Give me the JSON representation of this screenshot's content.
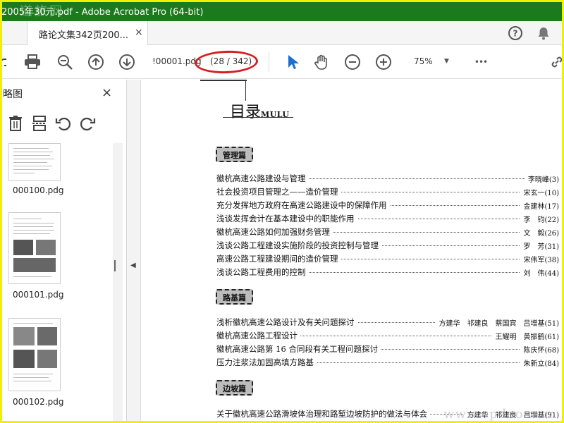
{
  "window": {
    "title": "2005年30元.pdf - Adobe Acrobat Pro (64-bit)",
    "watermark": "道旅网"
  },
  "tab": {
    "label": "路论文集342页200...",
    "close": "×"
  },
  "toolbar": {
    "filename": "!00001.pdg",
    "page_count": "(28 / 342)",
    "zoom": "75%",
    "more": "•••"
  },
  "sidebar": {
    "title": "略图",
    "close": "×",
    "thumbnails": [
      {
        "label": "000100.pdg"
      },
      {
        "label": "000101.pdg"
      },
      {
        "label": "000102.pdg"
      }
    ]
  },
  "document": {
    "heading": "目录",
    "heading_sub": "MULU",
    "sections": [
      {
        "name": "管理篇",
        "entries": [
          {
            "title": "徽杭高速公路建设与管理",
            "author": "李晓峰(3)"
          },
          {
            "title": "社会投资项目管理之——造价管理",
            "author": "宋玄一(10)"
          },
          {
            "title": "充分发挥地方政府在高速公路建设中的保障作用",
            "author": "金建林(17)"
          },
          {
            "title": "浅谈发挥会计在基本建设中的职能作用",
            "author": "李　钧(22)"
          },
          {
            "title": "徽杭高速公路如何加强财务管理",
            "author": "文　毅(26)"
          },
          {
            "title": "浅谈公路工程建设实施阶段的投资控制与管理",
            "author": "罗　芳(31)"
          },
          {
            "title": "高速公路工程建设期间的造价管理",
            "author": "宋伟军(38)"
          },
          {
            "title": "浅谈公路工程费用的控制",
            "author": "刘　伟(44)"
          }
        ]
      },
      {
        "name": "路基篇",
        "entries": [
          {
            "title": "浅析徽杭高速公路设计及有关问题探讨",
            "author": "方建华　祁建良　蔡国宾　吕增基(51)"
          },
          {
            "title": "徽杭高速公路工程设计",
            "author": "王耀明　黄振鹤(61)"
          },
          {
            "title": "徽杭高速公路第 16 合同段有关工程问题探讨",
            "author": "陈庆怀(68)"
          },
          {
            "title": "压力注浆法加固高填方路基",
            "author": "朱新立(84)"
          }
        ]
      },
      {
        "name": "边坡篇",
        "entries": [
          {
            "title": "关于徽杭高速公路滑坡体治理和路堑边坡防护的做法与体会",
            "author": "方建华　祁建良　吕增基(91)"
          }
        ]
      }
    ],
    "watermark": "www.cpdao.com"
  },
  "colors": {
    "titlebar": "#1b7a1b",
    "frame": "#f0f000",
    "annotation": "#d6201f",
    "accent_blue": "#1f6fd1",
    "tag_bg": "#bdbdbd"
  }
}
